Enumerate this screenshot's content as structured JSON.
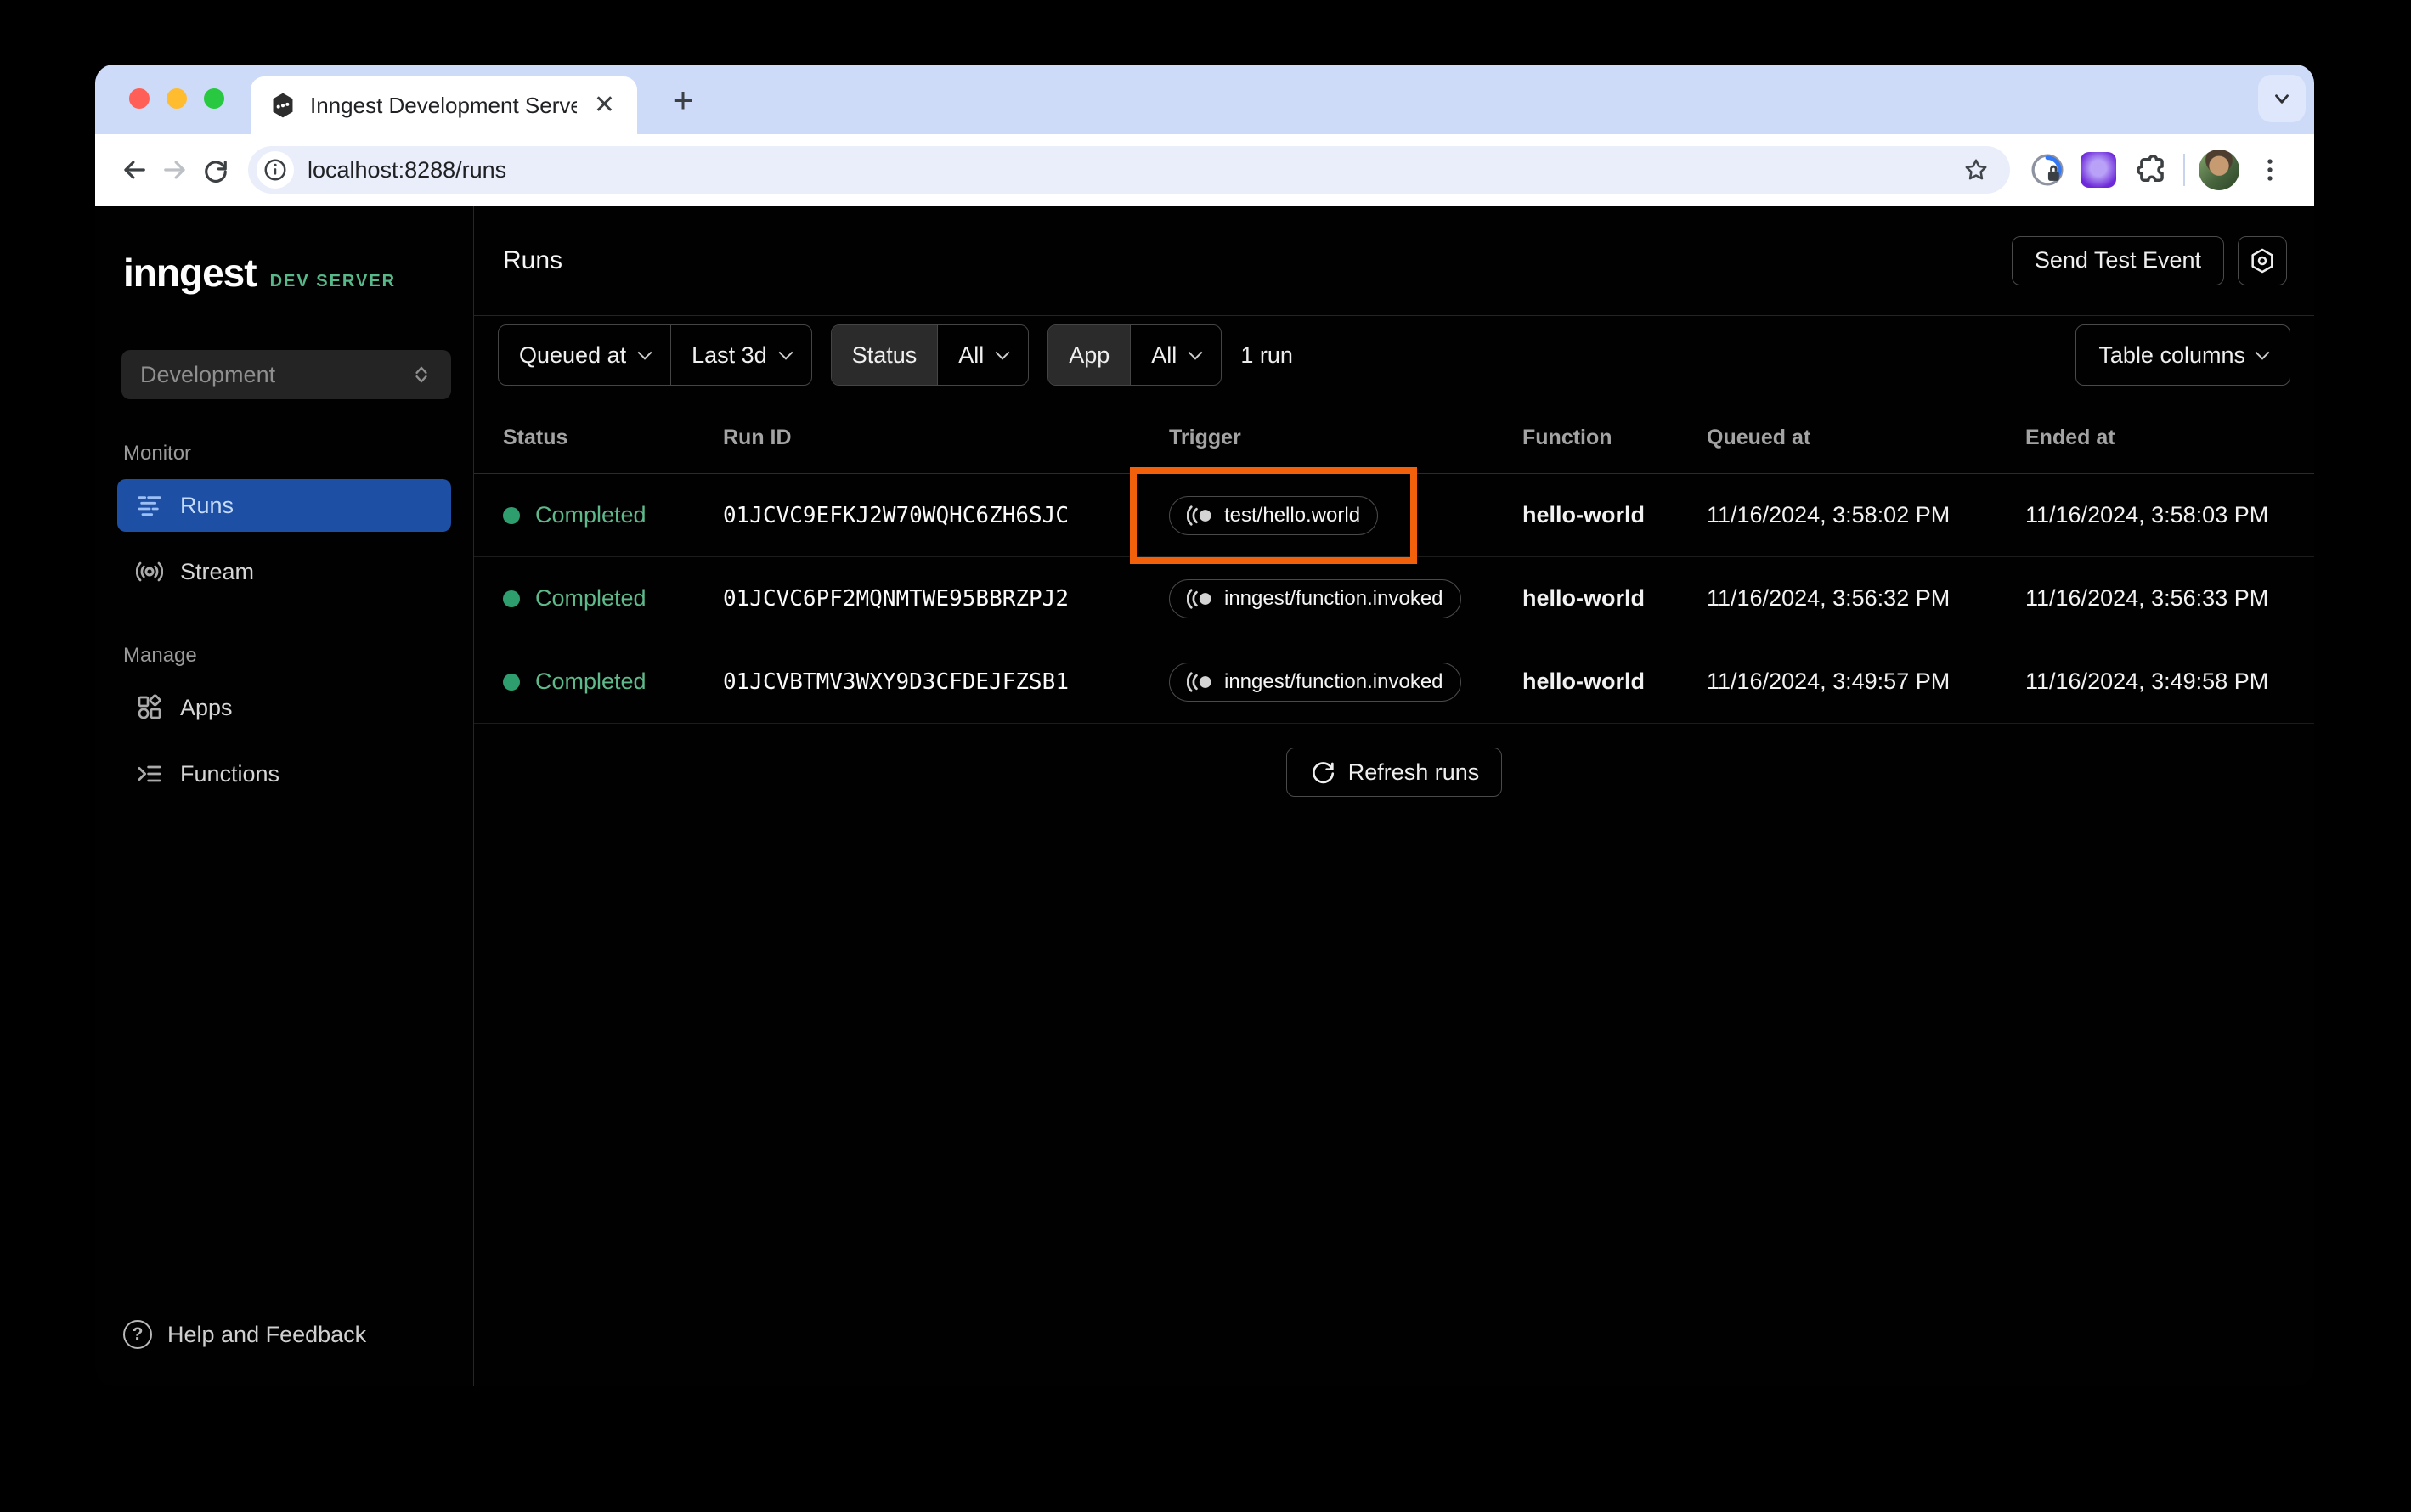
{
  "browser": {
    "tab_title": "Inngest Development Server",
    "url": "localhost:8288/runs"
  },
  "sidebar": {
    "logo": "inngest",
    "logo_badge": "DEV SERVER",
    "env_selector": "Development",
    "sections": [
      {
        "label": "Monitor",
        "items": [
          {
            "label": "Runs"
          },
          {
            "label": "Stream"
          }
        ]
      },
      {
        "label": "Manage",
        "items": [
          {
            "label": "Apps"
          },
          {
            "label": "Functions"
          }
        ]
      }
    ],
    "help": "Help and Feedback"
  },
  "header": {
    "title": "Runs",
    "send_test_event": "Send Test Event"
  },
  "filters": {
    "queued_at": "Queued at",
    "time_range": "Last 3d",
    "status_label": "Status",
    "status_value": "All",
    "app_label": "App",
    "app_value": "All",
    "run_count": "1 run",
    "table_columns": "Table columns"
  },
  "table": {
    "columns": [
      "Status",
      "Run ID",
      "Trigger",
      "Function",
      "Queued at",
      "Ended at"
    ],
    "rows": [
      {
        "status": "Completed",
        "run_id": "01JCVC9EFKJ2W70WQHC6ZH6SJC",
        "trigger": "test/hello.world",
        "function": "hello-world",
        "queued_at": "11/16/2024, 3:58:02 PM",
        "ended_at": "11/16/2024, 3:58:03 PM"
      },
      {
        "status": "Completed",
        "run_id": "01JCVC6PF2MQNMTWE95BBRZPJ2",
        "trigger": "inngest/function.invoked",
        "function": "hello-world",
        "queued_at": "11/16/2024, 3:56:32 PM",
        "ended_at": "11/16/2024, 3:56:33 PM"
      },
      {
        "status": "Completed",
        "run_id": "01JCVBTMV3WXY9D3CFDEJFZSB1",
        "trigger": "inngest/function.invoked",
        "function": "hello-world",
        "queued_at": "11/16/2024, 3:49:57 PM",
        "ended_at": "11/16/2024, 3:49:58 PM"
      }
    ],
    "refresh_label": "Refresh runs"
  },
  "colors": {
    "highlight_orange": "#f2600c",
    "active_blue": "#1d4fa5",
    "status_green": "#2f9e6e",
    "dev_server_green": "#57b88a"
  }
}
